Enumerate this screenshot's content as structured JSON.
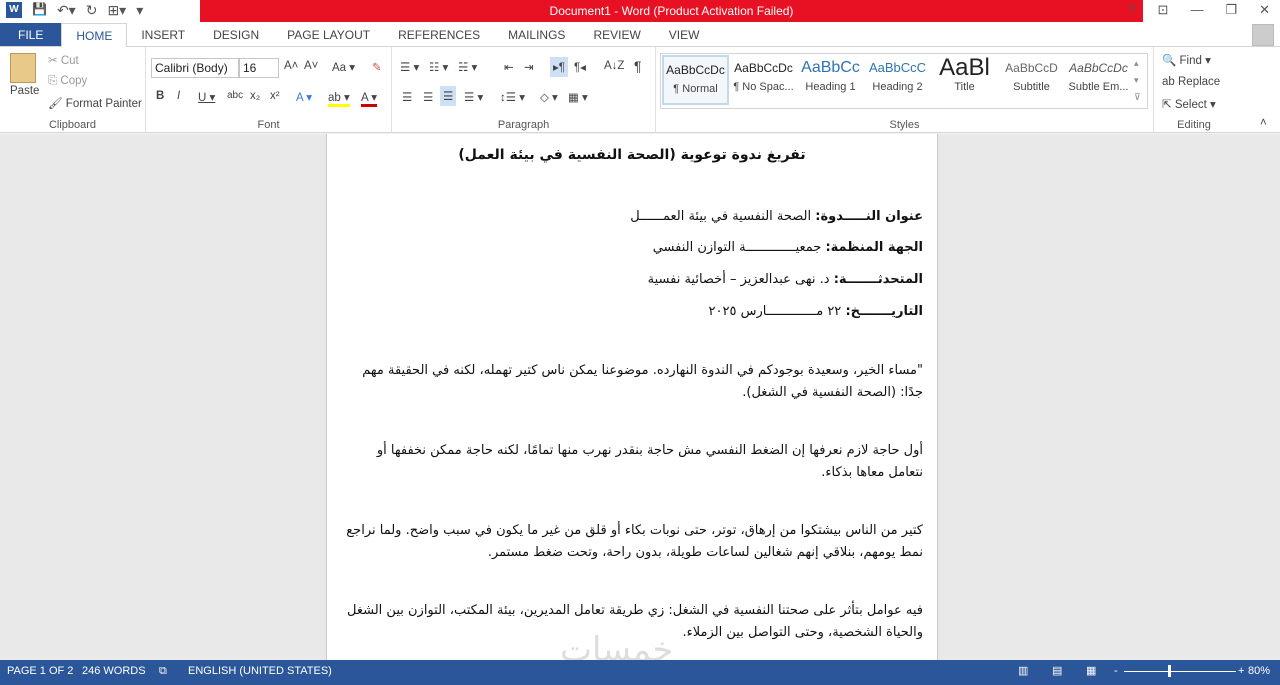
{
  "titlebar": {
    "title": "Document1 - Word (Product Activation Failed)",
    "help": "?",
    "ribbon_display": "⊡",
    "minimize": "—",
    "restore": "❐",
    "close": "✕"
  },
  "qat": {
    "word": "W",
    "save": "💾",
    "undo": "↶▾",
    "redo": "↻",
    "touch": "⊞▾",
    "customize": "▾"
  },
  "tabs": [
    "FILE",
    "HOME",
    "INSERT",
    "DESIGN",
    "PAGE LAYOUT",
    "REFERENCES",
    "MAILINGS",
    "REVIEW",
    "VIEW"
  ],
  "clipboard": {
    "paste": "Paste",
    "cut": "Cut",
    "copy": "Copy",
    "format_painter": "Format Painter",
    "label": "Clipboard"
  },
  "font": {
    "name": "Calibri (Body)",
    "size": "16",
    "grow": "A˄",
    "shrink": "A˅",
    "case": "Aa ▾",
    "clear": "✎",
    "bold": "B",
    "italic": "I",
    "underline": "U ▾",
    "strike": "abc",
    "sub": "x₂",
    "sup": "x²",
    "effects": "A ▾",
    "highlight": "ab ▾",
    "color": "A ▾",
    "label": "Font"
  },
  "paragraph": {
    "bullets": "☰ ▾",
    "numbering": "☷ ▾",
    "multilevel": "☵ ▾",
    "dec_indent": "⇤",
    "inc_indent": "⇥",
    "ltr": "▸¶",
    "rtl": "¶◂",
    "sort": "A↓Z",
    "show": "¶",
    "left": "☰",
    "center": "☰",
    "right": "☰",
    "justify": "☰ ▾",
    "spacing": "↕☰ ▾",
    "shading": "◇ ▾",
    "borders": "▦ ▾",
    "label": "Paragraph"
  },
  "styles": {
    "items": [
      {
        "preview": "AaBbCcDc",
        "name": "¶ Normal"
      },
      {
        "preview": "AaBbCcDc",
        "name": "¶ No Spac..."
      },
      {
        "preview": "AaBbCc",
        "name": "Heading 1"
      },
      {
        "preview": "AaBbCcC",
        "name": "Heading 2"
      },
      {
        "preview": "AaBl",
        "name": "Title"
      },
      {
        "preview": "AaBbCcD",
        "name": "Subtitle"
      },
      {
        "preview": "AaBbCcDc",
        "name": "Subtle Em..."
      }
    ],
    "label": "Styles"
  },
  "editing": {
    "find": "Find ▾",
    "replace": "Replace",
    "select": "Select ▾",
    "label": "Editing"
  },
  "document": {
    "title": "تفريغ ندوة توعوية (الصحة النفسية في بيئة العمل)",
    "fields": [
      {
        "label": "عنوان النـــــدوة:",
        "value": " الصحة النفسية في بيئة العمــــــل"
      },
      {
        "label": "الجهة المنظمة:",
        "value": " جمعيـــــــــــــة التوازن النفسي"
      },
      {
        "label": "المتحدثـــــــة:",
        "value": " د. نهى عبدالعزيز – أخصائية نفسية"
      },
      {
        "label": "التاريـــــــخ:",
        "value": " ٢٢ مـــــــــــــارس ٢٠٢٥"
      }
    ],
    "paragraphs": [
      "\"مساء الخير، وسعيدة بوجودكم في الندوة النهارده. موضوعنا يمكن ناس كتير تهمله، لكنه في الحقيقة مهم جدًا: (الصحة النفسية في الشغل).",
      "أول حاجة لازم نعرفها إن الضغط النفسي مش حاجة بنقدر نهرب منها تمامًا، لكنه حاجة ممكن نخففها أو نتعامل معاها بذكاء.",
      "كتير من الناس بيشتكوا من إرهاق، توتر، حتى نوبات بكاء أو قلق من غير ما يكون في سبب واضح. ولما نراجع نمط يومهم، بنلاقي إنهم شغالين لساعات طويلة، بدون راحة، وتحت ضغط مستمر.",
      "فيه عوامل بتأثر على صحتنا النفسية في الشغل: زي طريقة تعامل المديرين، بيئة المكتب، التوازن بين الشغل والحياة الشخصية، وحتى التواصل بين الزملاء."
    ]
  },
  "watermark": "خمسات",
  "status": {
    "page": "PAGE 1 OF 2",
    "words": "246 WORDS",
    "language": "ENGLISH (UNITED STATES)",
    "zoom": "80%",
    "zoom_percent": 80
  }
}
